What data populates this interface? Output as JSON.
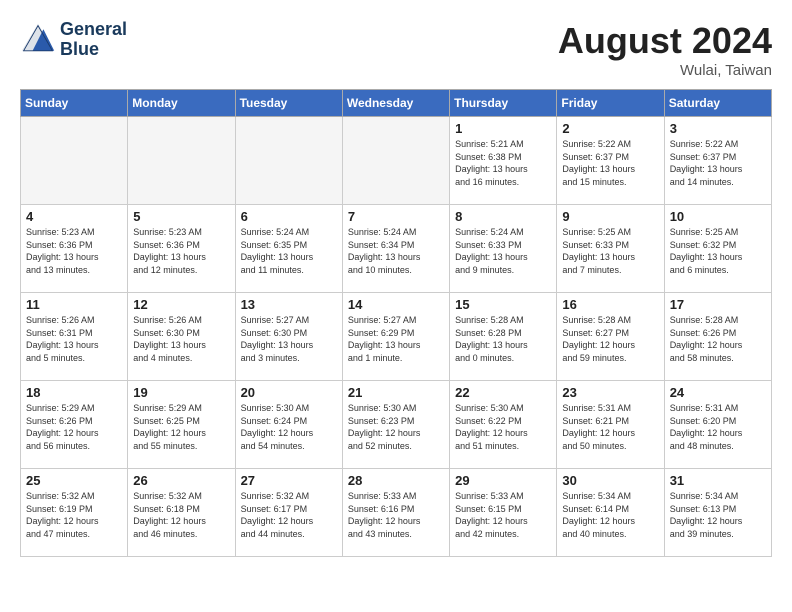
{
  "header": {
    "logo_line1": "General",
    "logo_line2": "Blue",
    "month_year": "August 2024",
    "location": "Wulai, Taiwan"
  },
  "weekdays": [
    "Sunday",
    "Monday",
    "Tuesday",
    "Wednesday",
    "Thursday",
    "Friday",
    "Saturday"
  ],
  "weeks": [
    [
      {
        "day": "",
        "empty": true
      },
      {
        "day": "",
        "empty": true
      },
      {
        "day": "",
        "empty": true
      },
      {
        "day": "",
        "empty": true
      },
      {
        "day": "1",
        "info": "Sunrise: 5:21 AM\nSunset: 6:38 PM\nDaylight: 13 hours\nand 16 minutes."
      },
      {
        "day": "2",
        "info": "Sunrise: 5:22 AM\nSunset: 6:37 PM\nDaylight: 13 hours\nand 15 minutes."
      },
      {
        "day": "3",
        "info": "Sunrise: 5:22 AM\nSunset: 6:37 PM\nDaylight: 13 hours\nand 14 minutes."
      }
    ],
    [
      {
        "day": "4",
        "info": "Sunrise: 5:23 AM\nSunset: 6:36 PM\nDaylight: 13 hours\nand 13 minutes."
      },
      {
        "day": "5",
        "info": "Sunrise: 5:23 AM\nSunset: 6:36 PM\nDaylight: 13 hours\nand 12 minutes."
      },
      {
        "day": "6",
        "info": "Sunrise: 5:24 AM\nSunset: 6:35 PM\nDaylight: 13 hours\nand 11 minutes."
      },
      {
        "day": "7",
        "info": "Sunrise: 5:24 AM\nSunset: 6:34 PM\nDaylight: 13 hours\nand 10 minutes."
      },
      {
        "day": "8",
        "info": "Sunrise: 5:24 AM\nSunset: 6:33 PM\nDaylight: 13 hours\nand 9 minutes."
      },
      {
        "day": "9",
        "info": "Sunrise: 5:25 AM\nSunset: 6:33 PM\nDaylight: 13 hours\nand 7 minutes."
      },
      {
        "day": "10",
        "info": "Sunrise: 5:25 AM\nSunset: 6:32 PM\nDaylight: 13 hours\nand 6 minutes."
      }
    ],
    [
      {
        "day": "11",
        "info": "Sunrise: 5:26 AM\nSunset: 6:31 PM\nDaylight: 13 hours\nand 5 minutes."
      },
      {
        "day": "12",
        "info": "Sunrise: 5:26 AM\nSunset: 6:30 PM\nDaylight: 13 hours\nand 4 minutes."
      },
      {
        "day": "13",
        "info": "Sunrise: 5:27 AM\nSunset: 6:30 PM\nDaylight: 13 hours\nand 3 minutes."
      },
      {
        "day": "14",
        "info": "Sunrise: 5:27 AM\nSunset: 6:29 PM\nDaylight: 13 hours\nand 1 minute."
      },
      {
        "day": "15",
        "info": "Sunrise: 5:28 AM\nSunset: 6:28 PM\nDaylight: 13 hours\nand 0 minutes."
      },
      {
        "day": "16",
        "info": "Sunrise: 5:28 AM\nSunset: 6:27 PM\nDaylight: 12 hours\nand 59 minutes."
      },
      {
        "day": "17",
        "info": "Sunrise: 5:28 AM\nSunset: 6:26 PM\nDaylight: 12 hours\nand 58 minutes."
      }
    ],
    [
      {
        "day": "18",
        "info": "Sunrise: 5:29 AM\nSunset: 6:26 PM\nDaylight: 12 hours\nand 56 minutes."
      },
      {
        "day": "19",
        "info": "Sunrise: 5:29 AM\nSunset: 6:25 PM\nDaylight: 12 hours\nand 55 minutes."
      },
      {
        "day": "20",
        "info": "Sunrise: 5:30 AM\nSunset: 6:24 PM\nDaylight: 12 hours\nand 54 minutes."
      },
      {
        "day": "21",
        "info": "Sunrise: 5:30 AM\nSunset: 6:23 PM\nDaylight: 12 hours\nand 52 minutes."
      },
      {
        "day": "22",
        "info": "Sunrise: 5:30 AM\nSunset: 6:22 PM\nDaylight: 12 hours\nand 51 minutes."
      },
      {
        "day": "23",
        "info": "Sunrise: 5:31 AM\nSunset: 6:21 PM\nDaylight: 12 hours\nand 50 minutes."
      },
      {
        "day": "24",
        "info": "Sunrise: 5:31 AM\nSunset: 6:20 PM\nDaylight: 12 hours\nand 48 minutes."
      }
    ],
    [
      {
        "day": "25",
        "info": "Sunrise: 5:32 AM\nSunset: 6:19 PM\nDaylight: 12 hours\nand 47 minutes."
      },
      {
        "day": "26",
        "info": "Sunrise: 5:32 AM\nSunset: 6:18 PM\nDaylight: 12 hours\nand 46 minutes."
      },
      {
        "day": "27",
        "info": "Sunrise: 5:32 AM\nSunset: 6:17 PM\nDaylight: 12 hours\nand 44 minutes."
      },
      {
        "day": "28",
        "info": "Sunrise: 5:33 AM\nSunset: 6:16 PM\nDaylight: 12 hours\nand 43 minutes."
      },
      {
        "day": "29",
        "info": "Sunrise: 5:33 AM\nSunset: 6:15 PM\nDaylight: 12 hours\nand 42 minutes."
      },
      {
        "day": "30",
        "info": "Sunrise: 5:34 AM\nSunset: 6:14 PM\nDaylight: 12 hours\nand 40 minutes."
      },
      {
        "day": "31",
        "info": "Sunrise: 5:34 AM\nSunset: 6:13 PM\nDaylight: 12 hours\nand 39 minutes."
      }
    ]
  ]
}
